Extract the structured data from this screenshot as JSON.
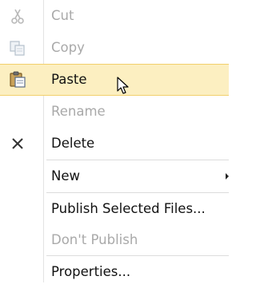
{
  "menu": {
    "items": [
      {
        "label": "Cut",
        "icon": "scissors-icon",
        "enabled": false
      },
      {
        "label": "Copy",
        "icon": "copy-icon",
        "enabled": false
      },
      {
        "label": "Paste",
        "icon": "paste-icon",
        "enabled": true,
        "highlighted": true
      },
      {
        "label": "Rename",
        "enabled": false
      },
      {
        "label": "Delete",
        "icon": "x-delete-icon",
        "enabled": true
      },
      {
        "label": "New",
        "enabled": true,
        "submenu": true
      },
      {
        "label": "Publish Selected Files...",
        "enabled": true
      },
      {
        "label": "Don't Publish",
        "enabled": false
      },
      {
        "label": "Properties...",
        "enabled": true
      }
    ],
    "highlight_color": "#fcefc1",
    "highlight_border_color": "#f2cf6c",
    "disabled_text_color": "#a9a9a9"
  }
}
